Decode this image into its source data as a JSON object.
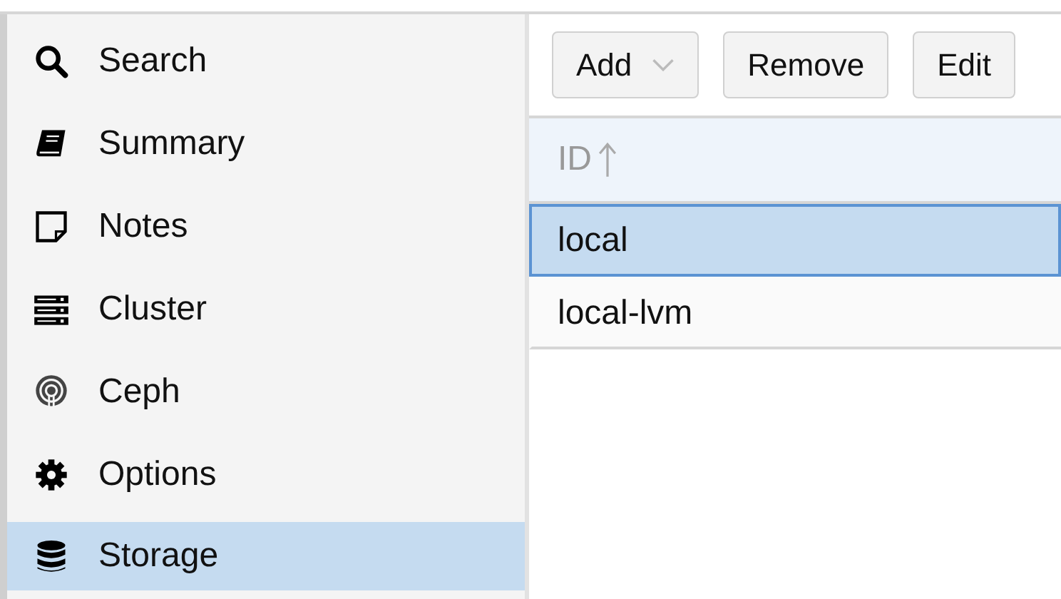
{
  "sidebar": {
    "items": [
      {
        "label": "Search",
        "kind": "search",
        "selected": false
      },
      {
        "label": "Summary",
        "kind": "book",
        "selected": false
      },
      {
        "label": "Notes",
        "kind": "note",
        "selected": false
      },
      {
        "label": "Cluster",
        "kind": "server",
        "selected": false
      },
      {
        "label": "Ceph",
        "kind": "ceph",
        "selected": false
      },
      {
        "label": "Options",
        "kind": "gear",
        "selected": false
      },
      {
        "label": "Storage",
        "kind": "database",
        "selected": true
      }
    ]
  },
  "toolbar": {
    "buttons": [
      {
        "label": "Add",
        "kind": "dropdown"
      },
      {
        "label": "Remove",
        "kind": "plain"
      },
      {
        "label": "Edit",
        "kind": "plain"
      }
    ]
  },
  "table": {
    "columns": [
      {
        "label": "ID",
        "sort_ascending": true
      }
    ],
    "rows": [
      {
        "id": "local",
        "selected": true
      },
      {
        "id": "local-lvm",
        "selected": false
      }
    ]
  }
}
